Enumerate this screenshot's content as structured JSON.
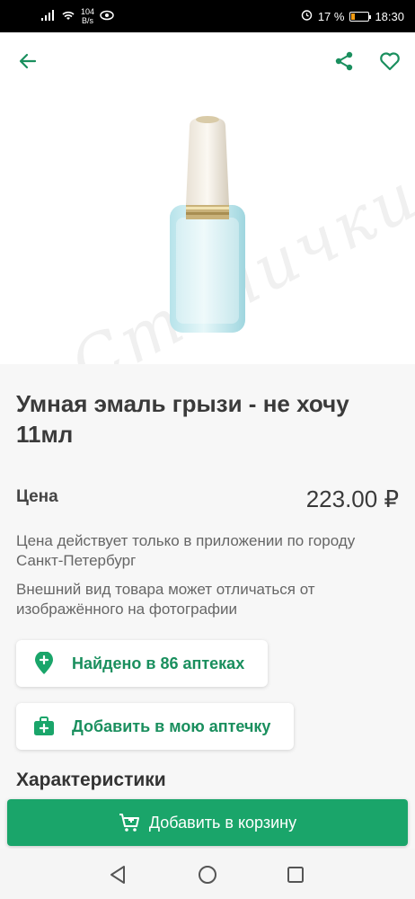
{
  "status_bar": {
    "net_speed_value": "104",
    "net_speed_unit": "B/s",
    "battery": "17 %",
    "time": "18:30"
  },
  "product": {
    "title": "Умная эмаль грызи - не хочу 11мл",
    "price_label": "Цена",
    "price": "223.00 ₽",
    "note_app_price": "Цена действует только в приложении по городу Санкт-Петербург",
    "note_appearance": "Внешний вид товара может отличаться от изображённого на фотографии",
    "watermark": "Столички"
  },
  "actions": {
    "found_in_pharmacies": "Найдено в 86 аптеках",
    "add_to_my_pharmacy": "Добавить в мою аптечку"
  },
  "characteristics_title": "Характеристики",
  "cart_button_label": "Добавить в корзину",
  "colors": {
    "accent": "#1aa56a",
    "accent_text": "#1a8f5e"
  }
}
